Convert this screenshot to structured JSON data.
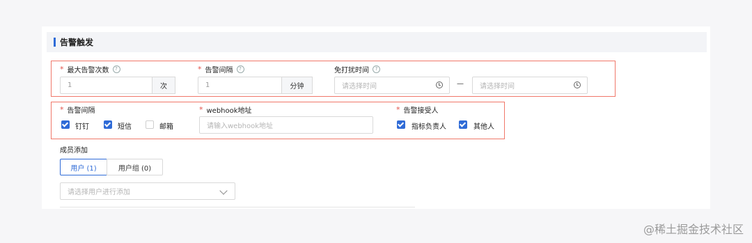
{
  "section": {
    "title": "告警触发"
  },
  "row1": {
    "max_alerts": {
      "label": "最大告警次数",
      "value": "1",
      "unit": "次"
    },
    "interval": {
      "label": "告警间隔",
      "value": "1",
      "unit": "分钟"
    },
    "quiet_time": {
      "label": "免打扰时间",
      "start_placeholder": "请选择时间",
      "end_placeholder": "请选择时间",
      "separator": "—"
    }
  },
  "row2": {
    "channels": {
      "label": "告警间隔",
      "options": [
        {
          "label": "钉钉",
          "checked": true
        },
        {
          "label": "短信",
          "checked": true
        },
        {
          "label": "邮箱",
          "checked": false
        }
      ]
    },
    "webhook": {
      "label": "webhook地址",
      "placeholder": "请输入webhook地址"
    },
    "receivers": {
      "label": "告警接受人",
      "options": [
        {
          "label": "指标负责人",
          "checked": true
        },
        {
          "label": "其他人",
          "checked": true
        }
      ]
    }
  },
  "members": {
    "label": "成员添加",
    "tabs": [
      {
        "label": "用户 (1)",
        "active": true
      },
      {
        "label": "用户组 (0)",
        "active": false
      }
    ],
    "select_placeholder": "请选择用户进行添加"
  },
  "watermark": "@稀土掘金技术社区",
  "colors": {
    "accent": "#2f6bd7",
    "required": "#e2524a",
    "highlight": "#f0786a"
  }
}
